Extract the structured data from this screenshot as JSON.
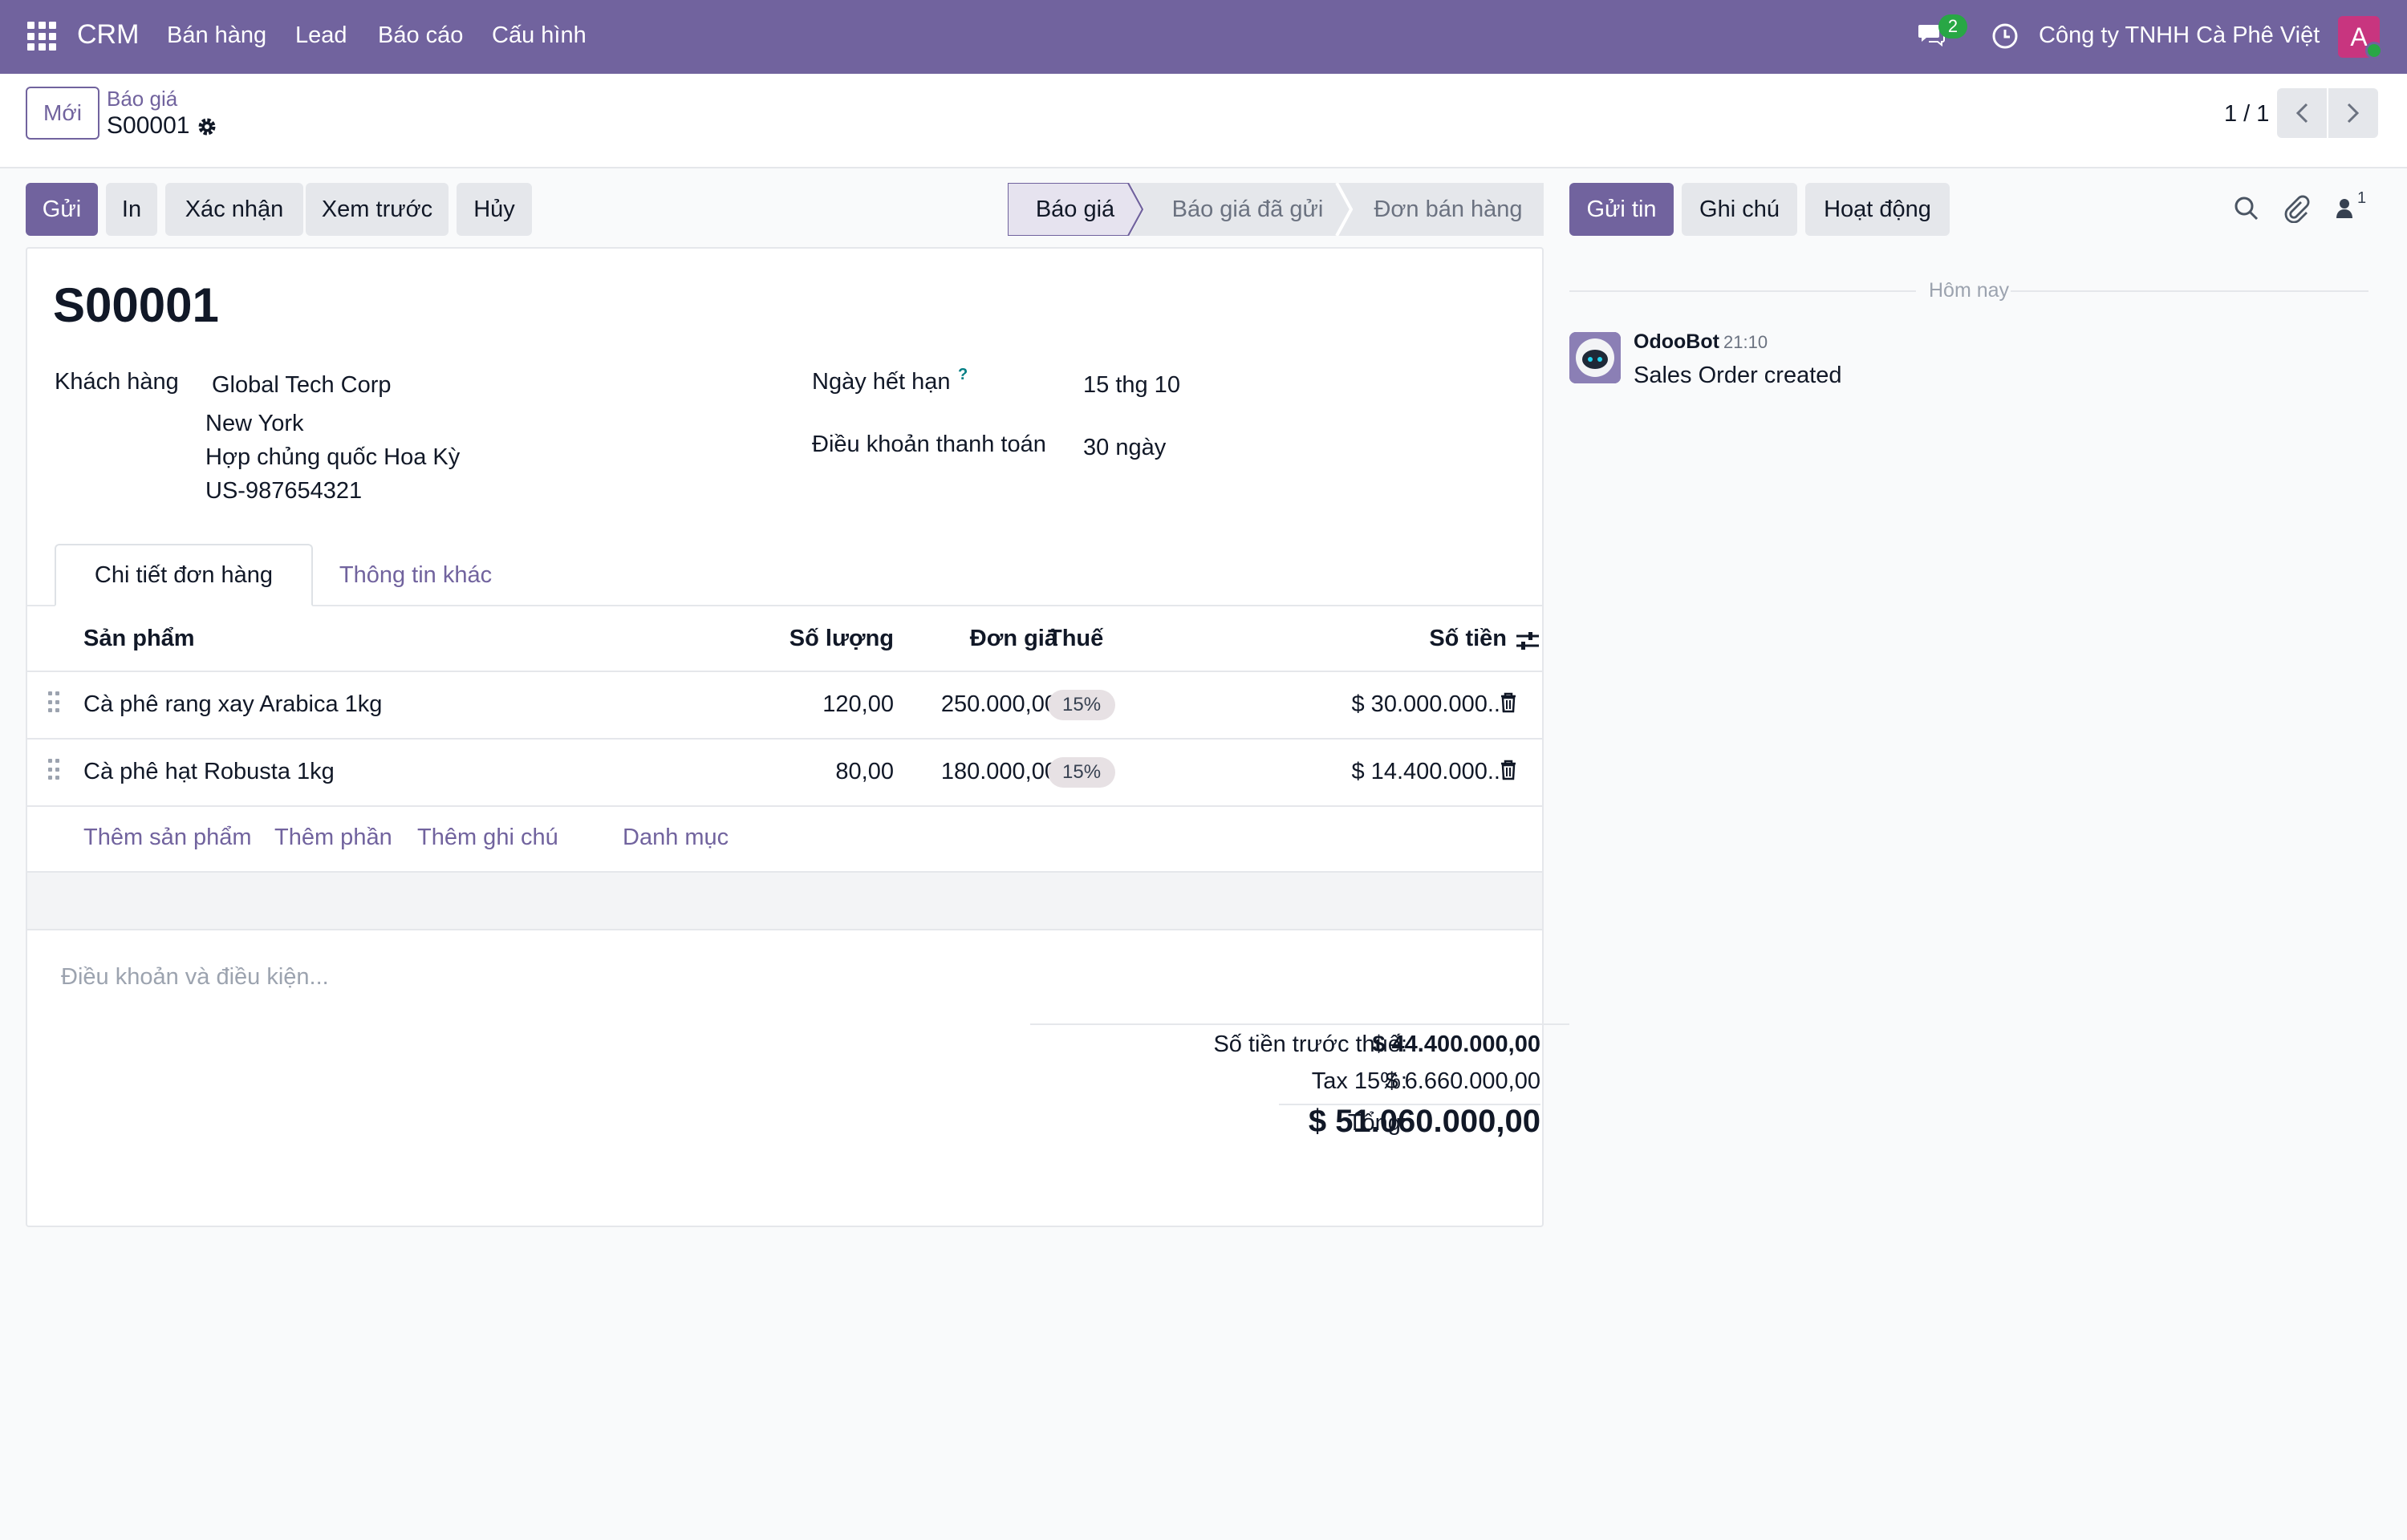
{
  "navbar": {
    "brand": "CRM",
    "menu": [
      "Bán hàng",
      "Lead",
      "Báo cáo",
      "Cấu hình"
    ],
    "chat_count": "2",
    "company": "Công ty TNHH Cà Phê Việt",
    "avatar_letter": "A",
    "color": "#71639e"
  },
  "control": {
    "new_label": "Mới",
    "breadcrumb_parent": "Báo giá",
    "record_name": "S00001",
    "pager": "1 / 1"
  },
  "actions": {
    "send": "Gửi",
    "print": "In",
    "confirm": "Xác nhận",
    "preview": "Xem trước",
    "cancel": "Hủy"
  },
  "status": {
    "stages": [
      "Báo giá",
      "Báo giá đã gửi",
      "Đơn bán hàng"
    ],
    "active": "Báo giá"
  },
  "form": {
    "title": "S00001",
    "customer_label": "Khách hàng",
    "customer_name": "Global Tech Corp",
    "customer_address": [
      "New York",
      "Hợp chủng quốc Hoa Kỳ",
      "US-987654321"
    ],
    "expiry_label": "Ngày hết hạn",
    "expiry_help": "?",
    "expiry_value": "15 thg 10",
    "terms_label": "Điều khoản thanh toán",
    "terms_value": "30 ngày"
  },
  "tabs": [
    "Chi tiết đơn hàng",
    "Thông tin khác"
  ],
  "table": {
    "headers": {
      "product": "Sản phẩm",
      "qty": "Số lượng",
      "price": "Đơn giá",
      "tax": "Thuế",
      "amount": "Số tiền"
    },
    "rows": [
      {
        "product": "Cà phê rang xay Arabica 1kg",
        "qty": "120,00",
        "price": "250.000,00",
        "tax": "15%",
        "amount": "$ 30.000.000..."
      },
      {
        "product": "Cà phê hạt Robusta 1kg",
        "qty": "80,00",
        "price": "180.000,00",
        "tax": "15%",
        "amount": "$ 14.400.000..."
      }
    ],
    "add_links": [
      "Thêm sản phẩm",
      "Thêm phần",
      "Thêm ghi chú",
      "Danh mục"
    ]
  },
  "terms_placeholder": "Điều khoản và điều kiện...",
  "totals": {
    "untaxed_label": "Số tiền trước thuế:",
    "untaxed_value": "$ 44.400.000,00",
    "tax_label": "Tax 15%:",
    "tax_value": "$ 6.660.000,00",
    "total_label": "Tổng:",
    "total_value": "$ 51.060.000,00"
  },
  "chatter": {
    "send_message": "Gửi tin",
    "log_note": "Ghi chú",
    "activities": "Hoạt động",
    "followers_count": "1",
    "date_separator": "Hôm nay",
    "message": {
      "author": "OdooBot",
      "time": "21:10",
      "body": "Sales Order created"
    }
  }
}
